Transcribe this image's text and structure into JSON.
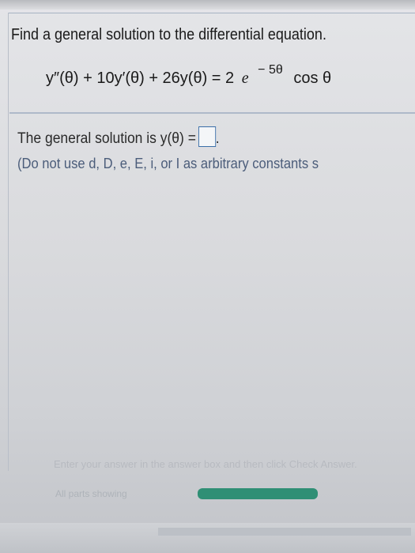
{
  "question": {
    "prompt": "Find a general solution to the differential equation.",
    "equation": {
      "lhs": "y″(θ) + 10y′(θ) + 26y(θ) = 2",
      "base": "e",
      "exponent": "− 5θ",
      "trailing": "cos θ"
    }
  },
  "answer": {
    "label": "The general solution is y(θ) =",
    "suffix": ".",
    "note": "(Do not use d, D, e, E, i, or I as arbitrary constants s"
  },
  "footer": {
    "instruction": "Enter your answer in the answer box and then click Check Answer.",
    "parts_label": "All parts showing",
    "progress": 1.0
  },
  "colors": {
    "progress": "#2f8f75",
    "answer_box_border": "#3a6ea8",
    "note_text": "#4b5d7a"
  }
}
